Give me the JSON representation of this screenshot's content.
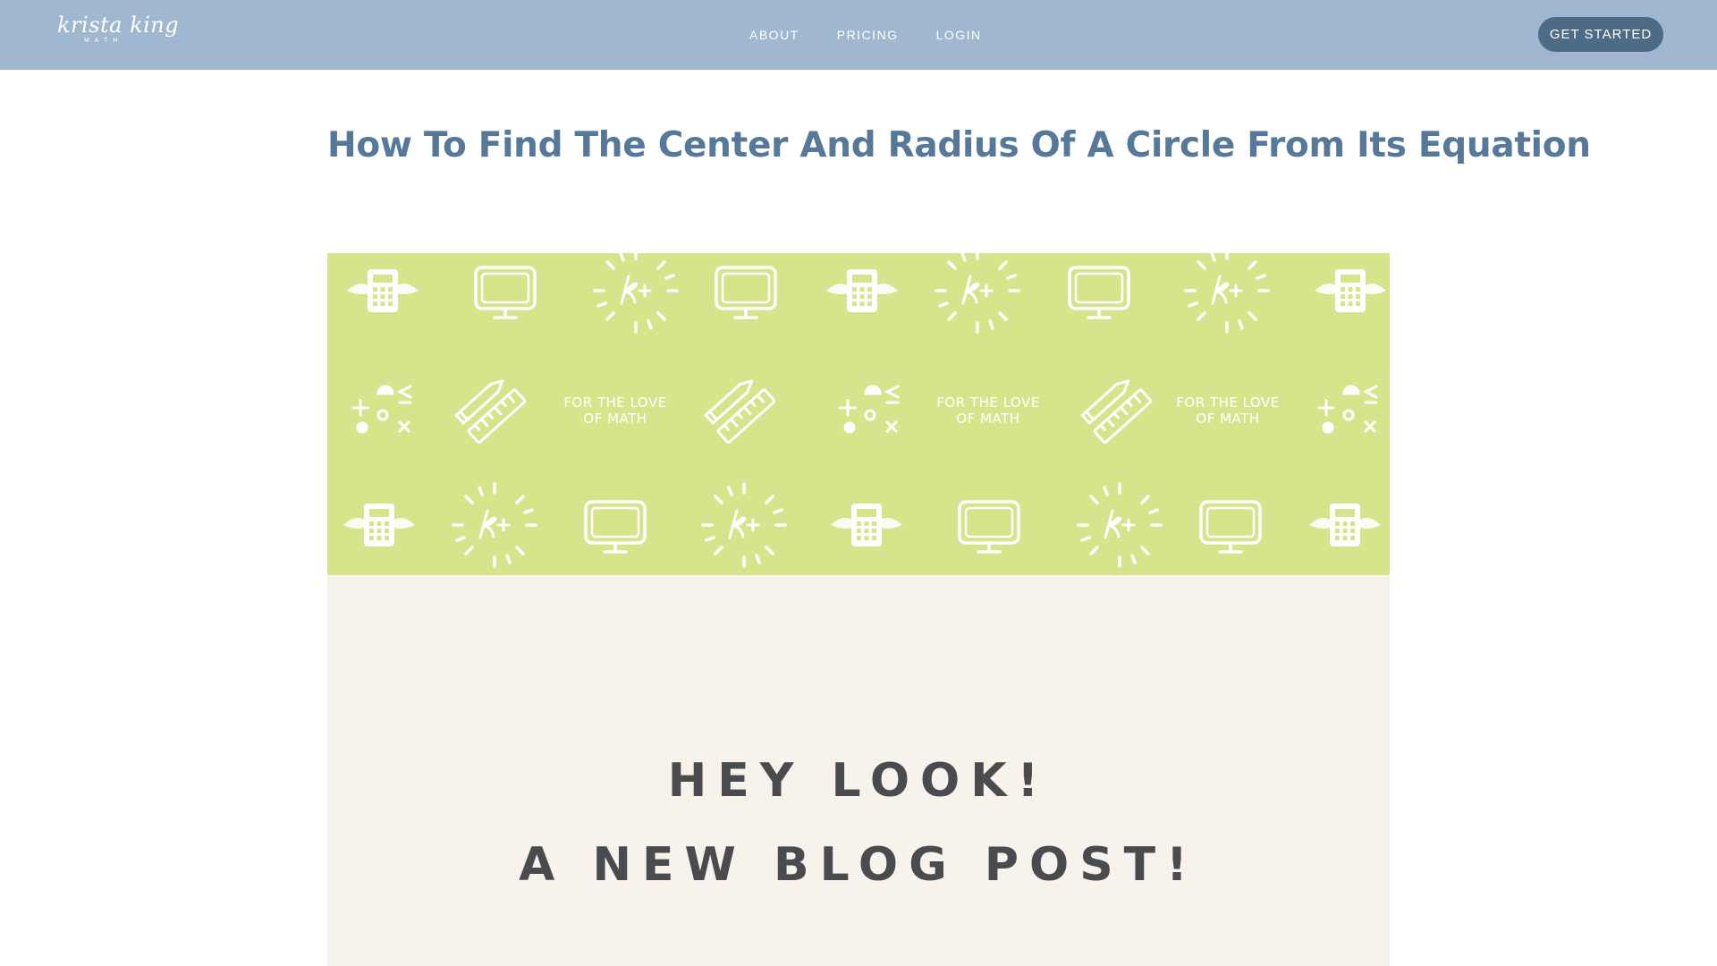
{
  "header": {
    "logo_text": "krista king",
    "logo_subtext": "MATH",
    "nav": [
      {
        "label": "ABOUT"
      },
      {
        "label": "PRICING"
      },
      {
        "label": "LOGIN"
      }
    ],
    "cta_label": "GET STARTED"
  },
  "article": {
    "title": "How To Find The Center And Radius Of A Circle From Its Equation"
  },
  "hero": {
    "pattern_text_line1": "FOR THE LOVE",
    "pattern_text_line2": "OF MATH",
    "headline_line1": "HEY LOOK!",
    "headline_line2": "A NEW BLOG POST!"
  },
  "colors": {
    "header_bg": "#9fb8cf",
    "cta_bg": "#4e6b85",
    "title": "#56789a",
    "pattern_bg": "#d7e48c",
    "cream_bg": "#f7f3ec",
    "headline": "#4a4b4e"
  }
}
